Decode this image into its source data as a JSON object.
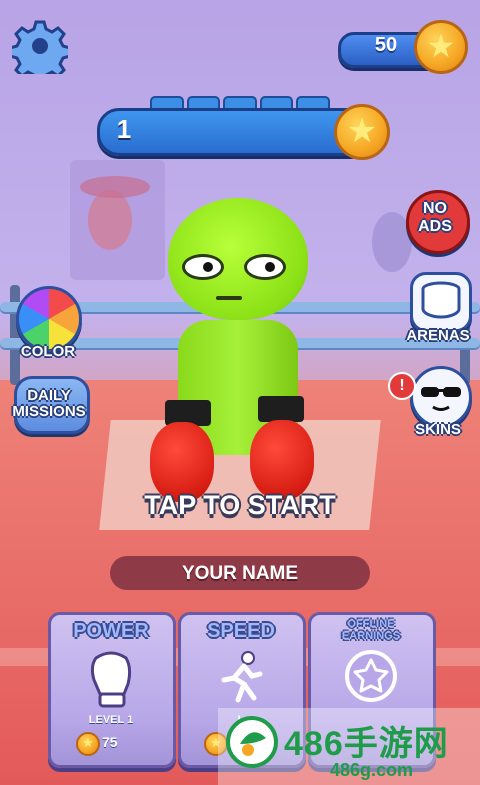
{
  "hud": {
    "coins": "50",
    "level": "1",
    "settings_icon": "gear-icon",
    "coin_icon": "star-coin-icon"
  },
  "side_left": [
    {
      "label": "COLOR",
      "icon": "color-wheel-icon"
    },
    {
      "label_line1": "DAILY",
      "label_line2": "MISSIONS",
      "icon": "missions-icon"
    }
  ],
  "side_right": [
    {
      "label_line1": "NO",
      "label_line2": "ADS",
      "icon": "no-ads-icon"
    },
    {
      "label": "ARENAS",
      "icon": "arena-icon"
    },
    {
      "label": "SKINS",
      "icon": "sunglasses-face-icon",
      "alert": "!"
    }
  ],
  "main": {
    "tap_to_start": "TAP TO START",
    "name_placeholder": "YOUR NAME"
  },
  "upgrades": [
    {
      "title": "POWER",
      "icon": "boxing-glove-icon",
      "level": "LEVEL 1",
      "cost": "75"
    },
    {
      "title": "SPEED",
      "icon": "running-man-icon",
      "level": "L",
      "cost": ""
    },
    {
      "title_line1": "OFFLINE",
      "title_line2": "EARNINGS",
      "icon": "star-icon"
    }
  ],
  "watermark": {
    "main": "486手游网",
    "sub": "486g.com"
  },
  "colors": {
    "accent_blue": "#2b6dd0",
    "character_green": "#8be016",
    "glove_red": "#d81e14"
  }
}
